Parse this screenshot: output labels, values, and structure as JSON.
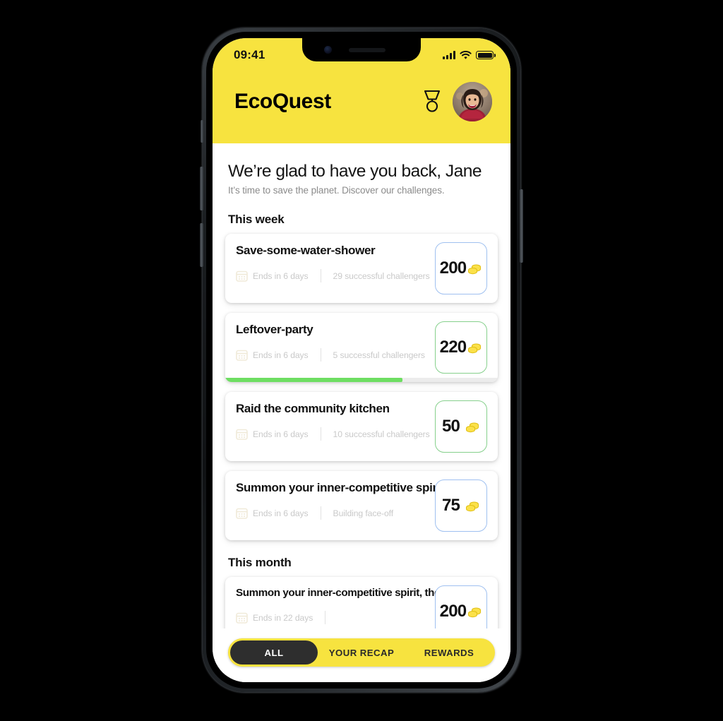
{
  "status_bar": {
    "time": "09:41",
    "signal_icon": "signal-bars-icon",
    "wifi_icon": "wifi-icon",
    "battery_icon": "battery-icon"
  },
  "header": {
    "brand": "EcoQuest",
    "medal_icon": "medal-icon",
    "avatar_icon": "user-avatar"
  },
  "greeting": {
    "title": "We’re glad to have you back, Jane",
    "subtitle": "It’s time to save the planet. Discover our challenges."
  },
  "sections": [
    {
      "title": "This week",
      "cards": [
        {
          "title": "Save-some-water-shower",
          "ends": "Ends in 6 days",
          "challengers": "29 successful challengers",
          "points": "200",
          "badge_color": "#9fc0f0",
          "progress": null
        },
        {
          "title": "Leftover-party",
          "ends": "Ends in 6 days",
          "challengers": "5 successful challengers",
          "points": "220",
          "badge_color": "#86d08c",
          "progress": 65
        },
        {
          "title": "Raid the community kitchen",
          "ends": "Ends in 6 days",
          "challengers": "10 successful challengers",
          "points": "50",
          "badge_color": "#86d08c",
          "progress": null
        },
        {
          "title": "Summon your inner-competitive spirit",
          "ends": "Ends in 6 days",
          "challengers": "Building face-off",
          "points": "75",
          "badge_color": "#9fc0f0",
          "progress": null
        }
      ]
    },
    {
      "title": "This month",
      "cards": [
        {
          "title": "Summon your inner-competitive spirit, the sequel",
          "ends": "Ends in 22 days",
          "challengers": "",
          "points": "200",
          "badge_color": "#9fc0f0",
          "progress": null
        }
      ]
    }
  ],
  "tabbar": {
    "tabs": [
      {
        "label": "ALL",
        "active": true
      },
      {
        "label": "YOUR RECAP",
        "active": false
      },
      {
        "label": "REWARDS",
        "active": false
      }
    ]
  },
  "colors": {
    "brand_yellow": "#f7e33f",
    "progress_green": "#6ede62",
    "badge_blue": "#9fc0f0",
    "badge_green": "#86d08c",
    "tab_active_bg": "#2e2e2e"
  }
}
